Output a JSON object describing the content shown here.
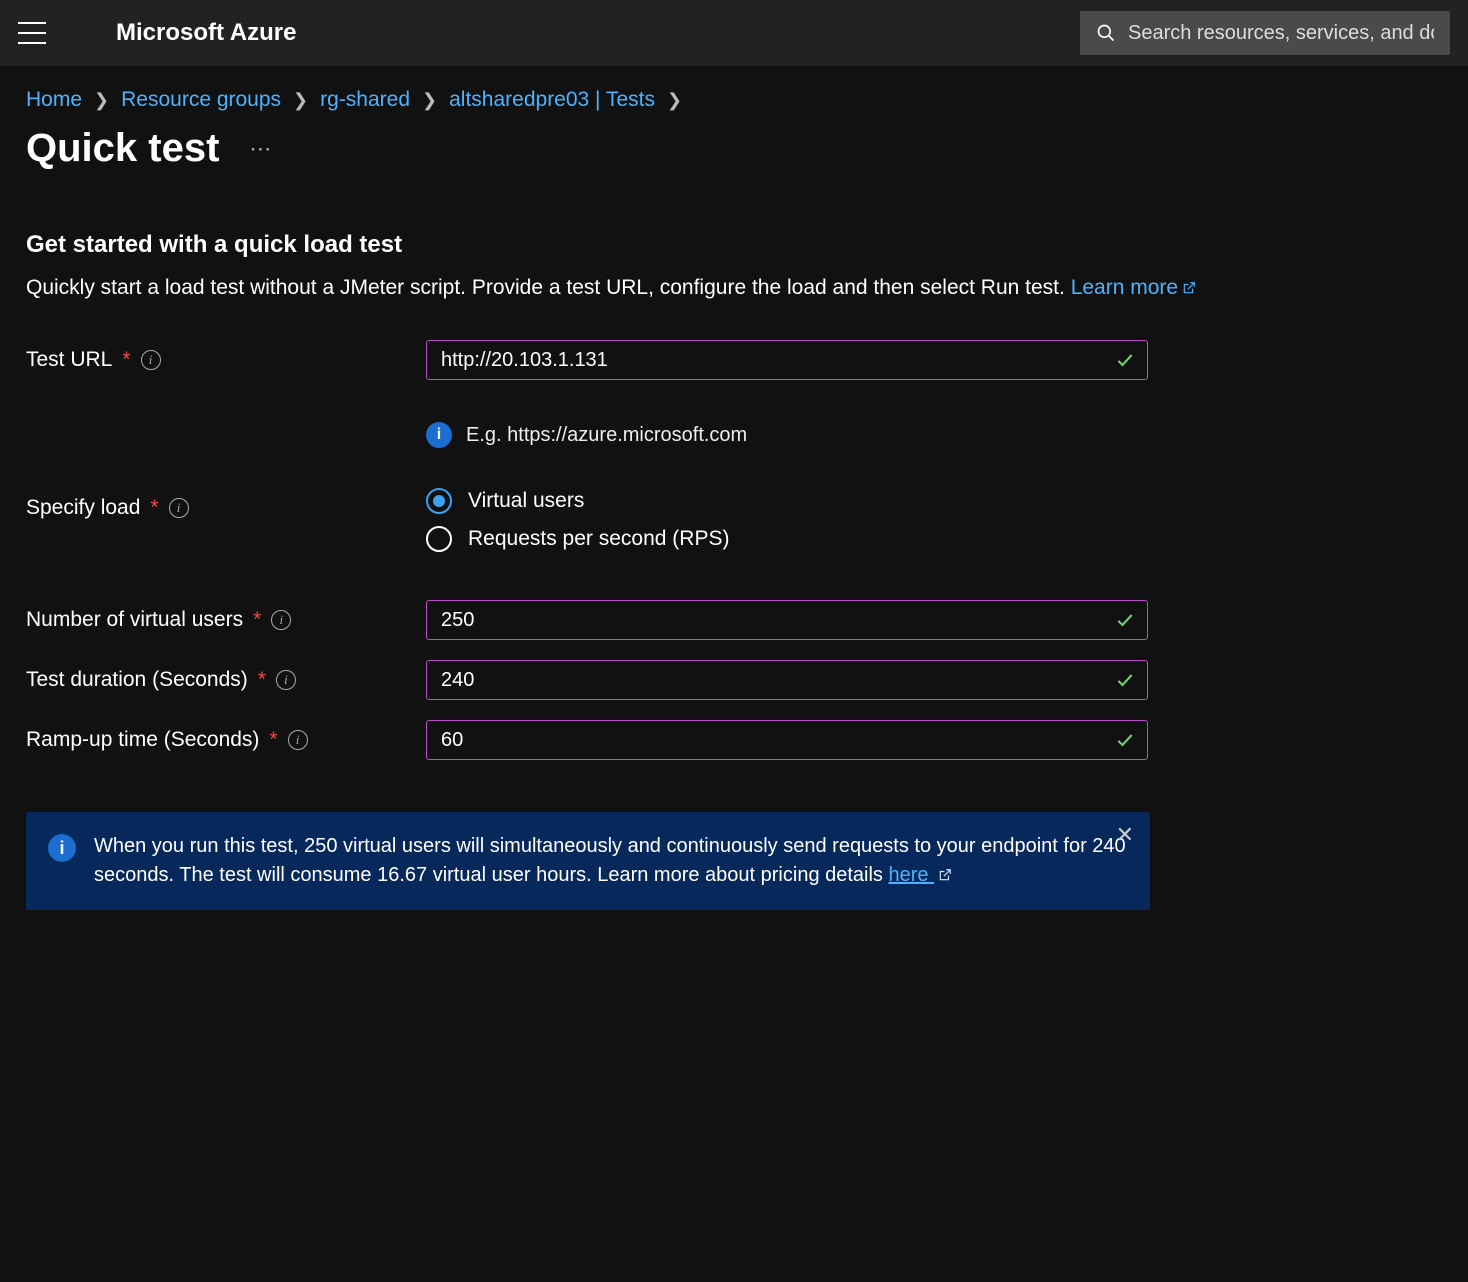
{
  "header": {
    "brand": "Microsoft Azure",
    "search_placeholder": "Search resources, services, and docs"
  },
  "breadcrumb": {
    "items": [
      "Home",
      "Resource groups",
      "rg-shared",
      "altsharedpre03 | Tests"
    ]
  },
  "page": {
    "title": "Quick test"
  },
  "intro": {
    "heading": "Get started with a quick load test",
    "body": "Quickly start a load test without a JMeter script. Provide a test URL, configure the load and then select Run test. ",
    "learn_more": "Learn more"
  },
  "fields": {
    "test_url": {
      "label": "Test URL",
      "value": "http://20.103.1.131",
      "hint": "E.g. https://azure.microsoft.com"
    },
    "specify_load": {
      "label": "Specify load",
      "options": [
        "Virtual users",
        "Requests per second (RPS)"
      ],
      "selected": 0
    },
    "virtual_users": {
      "label": "Number of virtual users",
      "value": "250"
    },
    "duration": {
      "label": "Test duration (Seconds)",
      "value": "240"
    },
    "rampup": {
      "label": "Ramp-up time (Seconds)",
      "value": "60"
    }
  },
  "banner": {
    "text": "When you run this test, 250 virtual users will simultaneously and continuously send requests to your endpoint for 240 seconds. The test will consume 16.67 virtual user hours. Learn more about pricing details ",
    "link_text": "here"
  }
}
